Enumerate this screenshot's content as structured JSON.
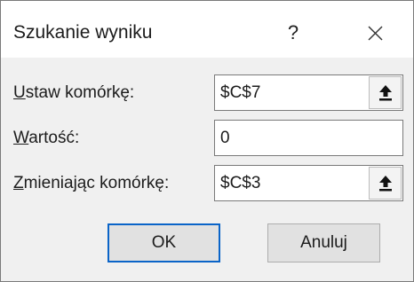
{
  "dialog": {
    "title": "Szukanie wyniku",
    "help_symbol": "?",
    "close_icon": "close-icon"
  },
  "fields": {
    "set_cell": {
      "label_accel": "U",
      "label_rest": "staw komórkę:",
      "value": "$C$7",
      "ref_icon": "collapse-dialog-arrow-icon"
    },
    "to_value": {
      "label_accel": "W",
      "label_rest": "artość:",
      "value": "0"
    },
    "changing_cell": {
      "label_accel": "Z",
      "label_rest": "mieniając komórkę:",
      "value": "$C$3",
      "ref_icon": "collapse-dialog-arrow-icon"
    }
  },
  "buttons": {
    "ok": "OK",
    "cancel": "Anuluj"
  },
  "colors": {
    "dialog_bg": "#f0f0f0",
    "titlebar_bg": "#ffffff",
    "default_button_border": "#0a64c8"
  }
}
